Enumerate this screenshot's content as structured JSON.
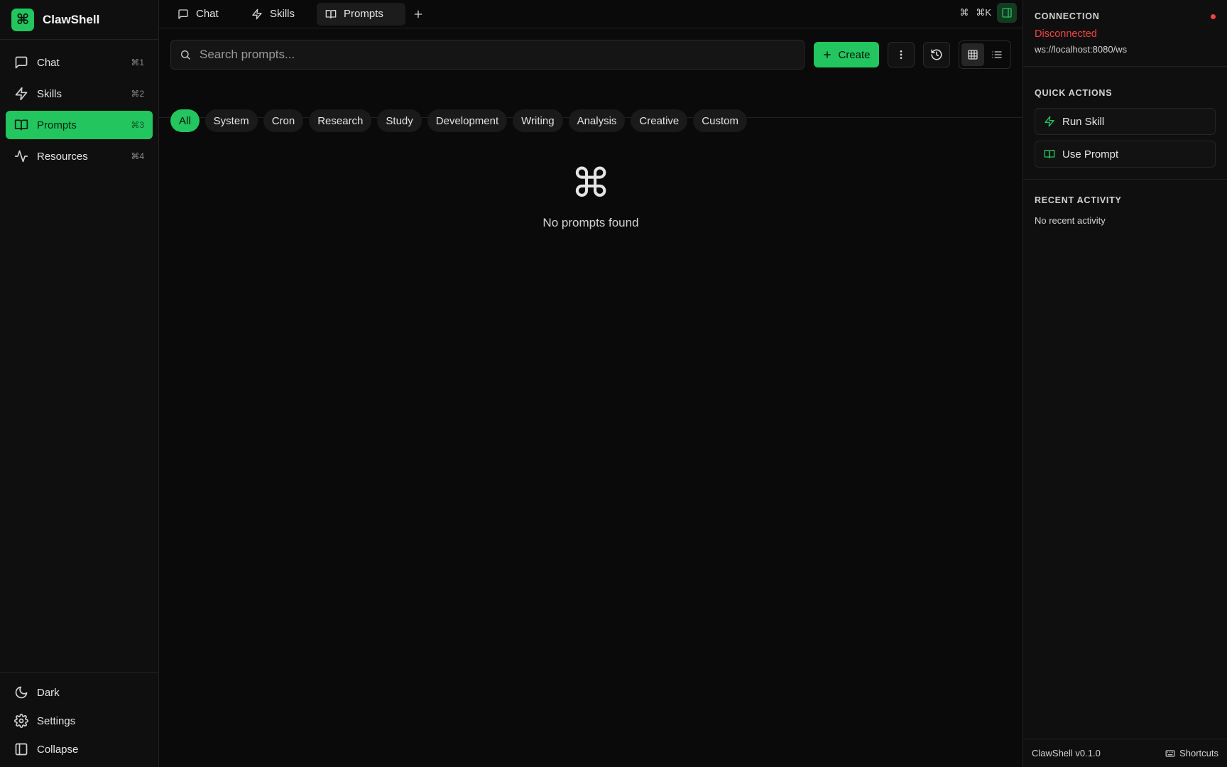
{
  "app": {
    "name": "ClawShell",
    "logo_glyph": "⌘",
    "version": "ClawShell v0.1.0",
    "accent": "#22c55e",
    "error": "#ef4444"
  },
  "sidebar": {
    "items": [
      {
        "label": "Chat",
        "shortcut": "⌘1",
        "icon": "chat-icon"
      },
      {
        "label": "Skills",
        "shortcut": "⌘2",
        "icon": "bolt-icon"
      },
      {
        "label": "Prompts",
        "shortcut": "⌘3",
        "icon": "book-icon",
        "active": true
      },
      {
        "label": "Resources",
        "shortcut": "⌘4",
        "icon": "activity-icon"
      }
    ],
    "bottom": {
      "theme_label": "Dark",
      "settings_label": "Settings",
      "collapse_label": "Collapse"
    }
  },
  "tabs": {
    "items": [
      {
        "label": "Chat",
        "icon": "chat-icon"
      },
      {
        "label": "Skills",
        "icon": "bolt-icon"
      },
      {
        "label": "Prompts",
        "icon": "book-icon",
        "active": true
      }
    ],
    "command_glyph": "⌘",
    "command_shortcut": "⌘K"
  },
  "toolbar": {
    "search_placeholder": "Search prompts...",
    "create_label": "Create"
  },
  "filters": [
    "All",
    "System",
    "Cron",
    "Research",
    "Study",
    "Development",
    "Writing",
    "Analysis",
    "Creative",
    "Custom"
  ],
  "empty_state": {
    "glyph": "⌘",
    "text": "No prompts found"
  },
  "right_panel": {
    "connection": {
      "heading": "CONNECTION",
      "state": "Disconnected",
      "url": "ws://localhost:8080/ws"
    },
    "quick_actions": {
      "heading": "QUICK ACTIONS",
      "run_skill": "Run Skill",
      "use_prompt": "Use Prompt"
    },
    "recent": {
      "heading": "RECENT ACTIVITY",
      "empty": "No recent activity"
    },
    "footer": {
      "shortcuts_label": "Shortcuts"
    }
  }
}
